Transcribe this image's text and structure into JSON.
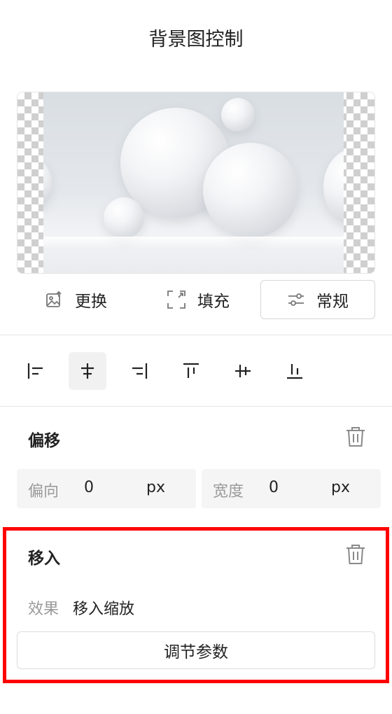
{
  "title": "背景图控制",
  "image_actions": [
    {
      "label": "更换",
      "icon": "image-replace-icon"
    },
    {
      "label": "填充",
      "icon": "expand-icon"
    },
    {
      "label": "常规",
      "icon": "sliders-icon",
      "active": true
    }
  ],
  "align_tools": [
    {
      "name": "align-left-icon"
    },
    {
      "name": "align-center-horizontal-icon",
      "active": true
    },
    {
      "name": "align-right-icon"
    },
    {
      "name": "align-top-icon"
    },
    {
      "name": "align-center-vertical-icon"
    },
    {
      "name": "align-bottom-icon"
    }
  ],
  "offset": {
    "title": "偏移",
    "direction": {
      "label": "偏向",
      "value": "0",
      "unit": "px"
    },
    "width": {
      "label": "宽度",
      "value": "0",
      "unit": "px"
    }
  },
  "move_in": {
    "title": "移入",
    "effect_label": "效果",
    "effect_value": "移入缩放",
    "adjust_button": "调节参数"
  },
  "colors": {
    "highlight": "#ff0000",
    "field_bg": "#f5f5f5"
  }
}
